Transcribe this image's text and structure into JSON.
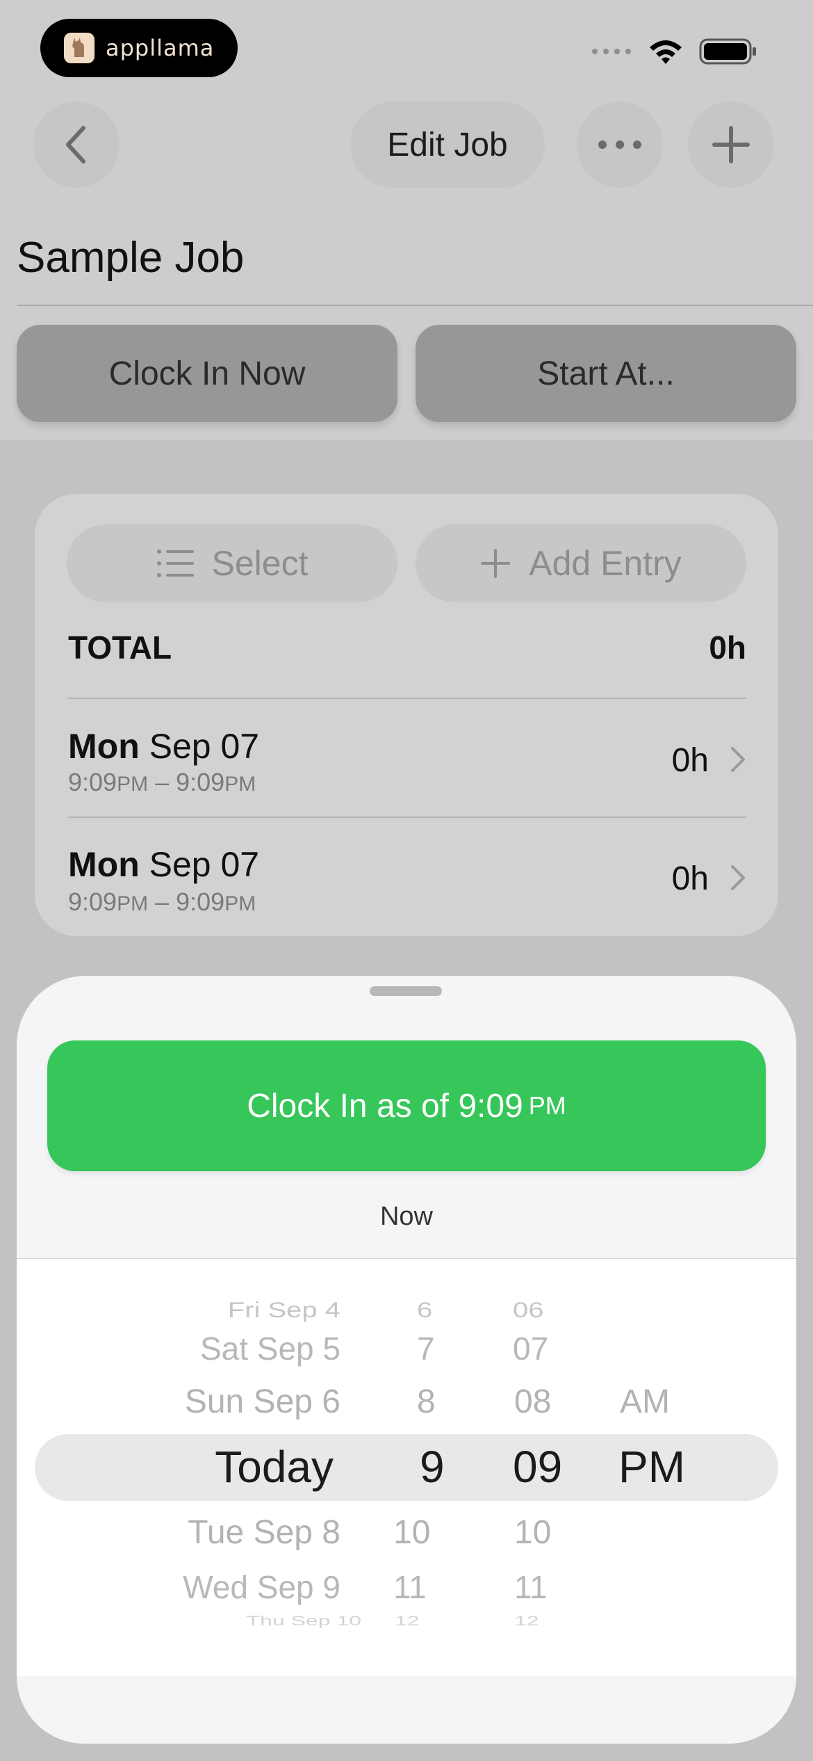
{
  "status_bar": {
    "logo_text": "appllama"
  },
  "nav": {
    "title": "Edit Job"
  },
  "job": {
    "name": "Sample Job",
    "clock_in_now_label": "Clock In Now",
    "start_at_label": "Start At..."
  },
  "card": {
    "select_label": "Select",
    "add_entry_label": "Add Entry",
    "total_label": "TOTAL",
    "total_value": "0h",
    "entries": [
      {
        "day": "Mon",
        "date": "Sep 07",
        "start": "9:09",
        "start_ampm": "PM",
        "sep": "–",
        "end": "9:09",
        "end_ampm": "PM",
        "duration": "0h"
      },
      {
        "day": "Mon",
        "date": "Sep 07",
        "start": "9:09",
        "start_ampm": "PM",
        "sep": "–",
        "end": "9:09",
        "end_ampm": "PM",
        "duration": "0h"
      }
    ]
  },
  "sheet": {
    "clock_in_label": "Clock In as of 9:09",
    "clock_in_ampm": "PM",
    "now_label": "Now",
    "picker": {
      "days": [
        "Fri Sep 4",
        "Sat Sep 5",
        "Sun Sep 6",
        "Today",
        "Tue Sep 8",
        "Wed Sep 9",
        "Thu Sep 10"
      ],
      "hours": [
        "6",
        "7",
        "8",
        "9",
        "10",
        "11",
        "12"
      ],
      "minutes": [
        "06",
        "07",
        "08",
        "09",
        "10",
        "11",
        "12"
      ],
      "ampm": [
        "AM",
        "PM"
      ]
    }
  },
  "colors": {
    "accent_green": "#36C659",
    "background": "#C2C2C4",
    "sheet": "#F5F5F7"
  }
}
